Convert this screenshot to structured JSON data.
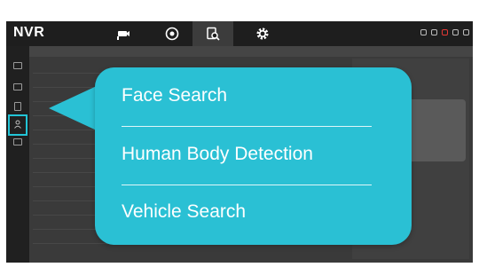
{
  "app": {
    "brand": "NVR"
  },
  "topnav": {
    "items": [
      {
        "icon": "camera-icon"
      },
      {
        "icon": "playback-icon"
      },
      {
        "icon": "search-icon",
        "active": true
      },
      {
        "icon": "gear-icon"
      }
    ],
    "right_icons": [
      "info-icon",
      "display-icon",
      "alarm-icon",
      "download-icon",
      "power-icon"
    ]
  },
  "sidebar": {
    "items": [
      "monitor-icon",
      "picture-icon",
      "document-icon",
      "user-icon",
      "vehicle-icon"
    ],
    "active": "user-icon"
  },
  "popup": {
    "items": [
      {
        "label": "Face Search"
      },
      {
        "label": "Human Body Detection"
      },
      {
        "label": "Vehicle Search"
      }
    ]
  },
  "colors": {
    "accent": "#2ac0d4",
    "frame": "#2f2f2f",
    "topbar": "#1e1e1e"
  }
}
